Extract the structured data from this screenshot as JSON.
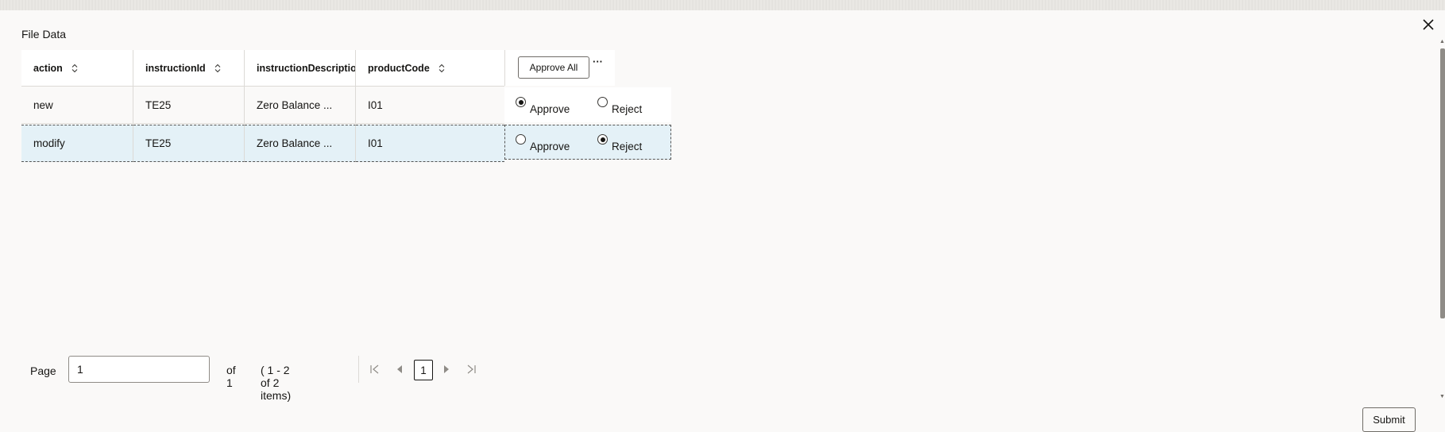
{
  "dialog": {
    "title": "File Data"
  },
  "table": {
    "columns": [
      {
        "label": "action"
      },
      {
        "label": "instructionId"
      },
      {
        "label": "instructionDescription"
      },
      {
        "label": "productCode"
      }
    ],
    "approve_all_label": "Approve All",
    "more_label": "···",
    "rows": [
      {
        "action": "new",
        "instructionId": "TE25",
        "instructionDescription": "Zero Balance ...",
        "productCode": "I01",
        "decision": "Approve"
      },
      {
        "action": "modify",
        "instructionId": "TE25",
        "instructionDescription": "Zero Balance ...",
        "productCode": "I01",
        "decision": "Reject"
      }
    ],
    "option_approve": "Approve",
    "option_reject": "Reject"
  },
  "pagination": {
    "page_label": "Page",
    "page_value": "1",
    "of_label": "of 1",
    "items_label": "( 1 - 2 of 2 items)",
    "current_page": "1"
  },
  "footer": {
    "submit_label": "Submit"
  },
  "icons": {
    "close": "close-icon",
    "sort": "sort-icon",
    "first": "first-page-icon",
    "prev": "previous-page-icon",
    "next": "next-page-icon",
    "last": "last-page-icon"
  },
  "colors": {
    "selected_row": "#e4f1f7",
    "background": "#faf9f8",
    "border": "#dcdad6"
  }
}
